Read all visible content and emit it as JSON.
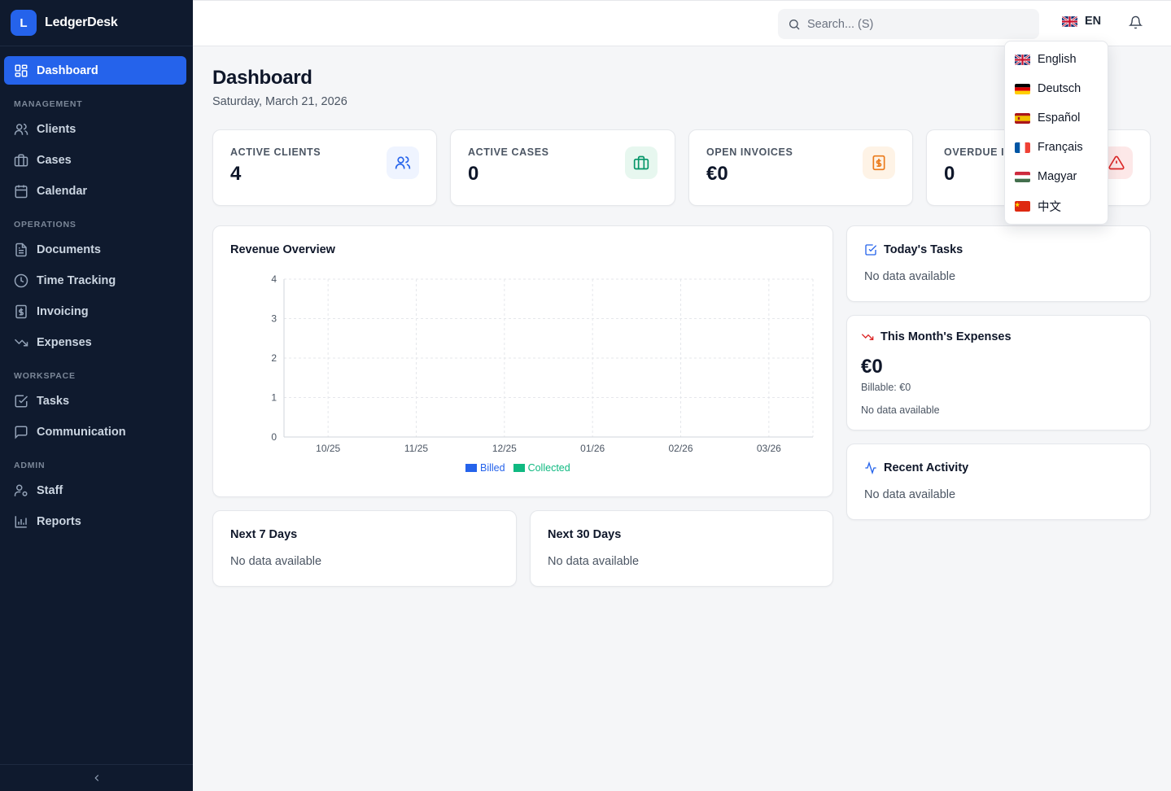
{
  "app": {
    "logo_letter": "L",
    "name": "LedgerDesk"
  },
  "sidebar": {
    "dashboard": "Dashboard",
    "sections": {
      "management": "MANAGEMENT",
      "operations": "OPERATIONS",
      "workspace": "WORKSPACE",
      "admin": "ADMIN"
    },
    "items": {
      "clients": "Clients",
      "cases": "Cases",
      "calendar": "Calendar",
      "documents": "Documents",
      "time_tracking": "Time Tracking",
      "invoicing": "Invoicing",
      "expenses": "Expenses",
      "tasks": "Tasks",
      "communication": "Communication",
      "staff": "Staff",
      "reports": "Reports"
    },
    "collapse_icon": "chevron-left-icon"
  },
  "header": {
    "search_placeholder": "Search... (S)",
    "language_code": "EN",
    "bell_icon": "bell-icon"
  },
  "language_menu": [
    {
      "label": "English",
      "flag": "gb"
    },
    {
      "label": "Deutsch",
      "flag": "de"
    },
    {
      "label": "Español",
      "flag": "es"
    },
    {
      "label": "Français",
      "flag": "fr"
    },
    {
      "label": "Magyar",
      "flag": "hu"
    },
    {
      "label": "中文",
      "flag": "cn"
    }
  ],
  "page": {
    "title": "Dashboard",
    "date": "Saturday, March 21, 2026"
  },
  "stats": [
    {
      "label": "ACTIVE CLIENTS",
      "value": "4",
      "color": "#2563eb",
      "bg": "#eff4ff"
    },
    {
      "label": "ACTIVE CASES",
      "value": "0",
      "color": "#059669",
      "bg": "#e7f7ef"
    },
    {
      "label": "OPEN INVOICES",
      "value": "€0",
      "color": "#ea7a1a",
      "bg": "#fef3e6"
    },
    {
      "label": "OVERDUE IN",
      "value": "0",
      "color": "#dc2626",
      "bg": "#fde8e8"
    }
  ],
  "revenue": {
    "title": "Revenue Overview",
    "legend": {
      "billed": "Billed",
      "collected": "Collected"
    },
    "colors": {
      "billed": "#2563eb",
      "collected": "#10b981"
    }
  },
  "chart_data": {
    "type": "bar",
    "categories": [
      "10/25",
      "11/25",
      "12/25",
      "01/26",
      "02/26",
      "03/26"
    ],
    "series": [
      {
        "name": "Billed",
        "values": [
          0,
          0,
          0,
          0,
          0,
          0
        ]
      },
      {
        "name": "Collected",
        "values": [
          0,
          0,
          0,
          0,
          0,
          0
        ]
      }
    ],
    "yticks": [
      "0",
      "1",
      "2",
      "3",
      "4"
    ],
    "ylim": [
      0,
      4
    ],
    "grid": true,
    "legend_position": "bottom"
  },
  "tasks_card": {
    "title": "Today's Tasks",
    "empty": "No data available"
  },
  "expenses_card": {
    "title": "This Month's Expenses",
    "amount": "€0",
    "billable": "Billable: €0",
    "empty": "No data available"
  },
  "activity_card": {
    "title": "Recent Activity",
    "empty": "No data available"
  },
  "next7": {
    "title": "Next 7 Days",
    "empty": "No data available"
  },
  "next30": {
    "title": "Next 30 Days",
    "empty": "No data available"
  }
}
